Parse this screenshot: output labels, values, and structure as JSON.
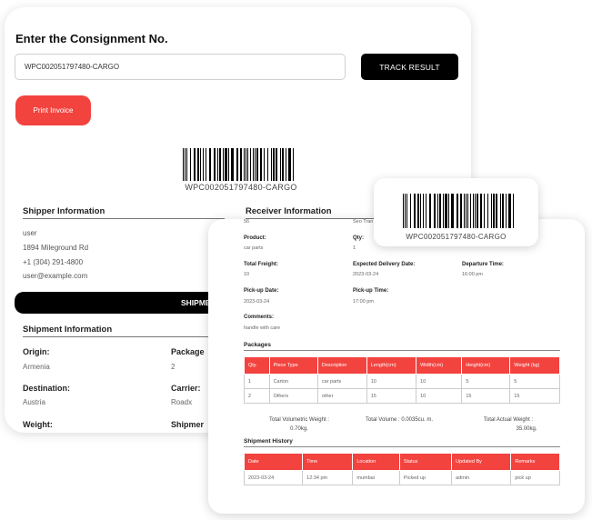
{
  "tracker": {
    "title": "Enter the Consignment No.",
    "consignment_value": "WPC002051797480-CARGO",
    "track_label": "TRACK RESULT",
    "print_label": "Print Invoice",
    "barcode_text": "WPC002051797480-CARGO"
  },
  "shipper": {
    "title": "Shipper Information",
    "name": "user",
    "address": "1894 Mileground Rd",
    "phone": "+1 (304) 291-4800",
    "email": "user@example.com"
  },
  "receiver": {
    "title": "Receiver Information"
  },
  "shipment_bar": {
    "label": "SHIPME"
  },
  "shipment": {
    "title": "Shipment Information",
    "origin_label": "Origin:",
    "origin": "Armenia",
    "package_label": "Package",
    "package": "2",
    "destination_label": "Destination:",
    "destination": "Austria",
    "carrier_label": "Carrier:",
    "carrier": "Roadx",
    "weight_label": "Weight:",
    "shipment_label": "Shipmer"
  },
  "floating_barcode": {
    "text": "WPC002051797480-CARGO"
  },
  "invoice": {
    "top_left": "56",
    "top_right": "Seo Tran",
    "product_label": "Product:",
    "product": "car parts",
    "qty_label": "Qty:",
    "qty": "1",
    "freight_label": "Total Freight:",
    "freight": "10",
    "delivery_label": "Expected Delivery Date:",
    "delivery": "2023-03-24",
    "departure_label": "Departure Time:",
    "departure": "16:00 pm",
    "pickup_date_label": "Pick-up Date:",
    "pickup_date": "2023-03-24",
    "pickup_time_label": "Pick-up Time:",
    "pickup_time": "17:00 pm",
    "comments_label": "Comments:",
    "comments": "handle with care",
    "packages_title": "Packages",
    "packages_headers": [
      "Qty.",
      "Piece Type",
      "Description",
      "Length(cm)",
      "Width(cm)",
      "Height(cm)",
      "Weight (kg)"
    ],
    "packages_rows": [
      [
        "1",
        "Carton",
        "car parts",
        "10",
        "10",
        "5",
        "5"
      ],
      [
        "2",
        "Others",
        "other",
        "15",
        "10",
        "15",
        "15"
      ]
    ],
    "vol_weight_label": "Total Volumetric Weight :",
    "vol_weight": "0.70kg.",
    "volume_label": "Total Volume : 0.0035cu. m.",
    "actual_weight_label": "Total Actual Weight :",
    "actual_weight": "35.00kg.",
    "history_title": "Shipment History",
    "history_headers": [
      "Date",
      "Time",
      "Location",
      "Status",
      "Updated By",
      "Remarks"
    ],
    "history_rows": [
      [
        "2023-03-24",
        "12:34 pm",
        "mumbai",
        "Picked up",
        "admin",
        "pick up"
      ]
    ]
  },
  "colors": {
    "accent": "#f2433f",
    "dark": "#000000"
  }
}
